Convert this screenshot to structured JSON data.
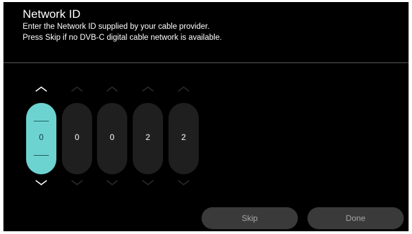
{
  "header": {
    "title": "Network ID",
    "line1": "Enter the Network ID supplied by your cable provider.",
    "line2": "Press Skip if no DVB-C digital cable network is available."
  },
  "digits": [
    {
      "value": "0",
      "selected": true
    },
    {
      "value": "0",
      "selected": false
    },
    {
      "value": "0",
      "selected": false
    },
    {
      "value": "2",
      "selected": false
    },
    {
      "value": "2",
      "selected": false
    }
  ],
  "buttons": {
    "skip_label": "Skip",
    "done_label": "Done"
  },
  "colors": {
    "background": "#000000",
    "selected_digit": "#6dd3d1",
    "digit_pill": "#1f1f1f",
    "button": "#3a3a3a"
  },
  "icons": {
    "up": "chevron-up-icon",
    "down": "chevron-down-icon"
  }
}
